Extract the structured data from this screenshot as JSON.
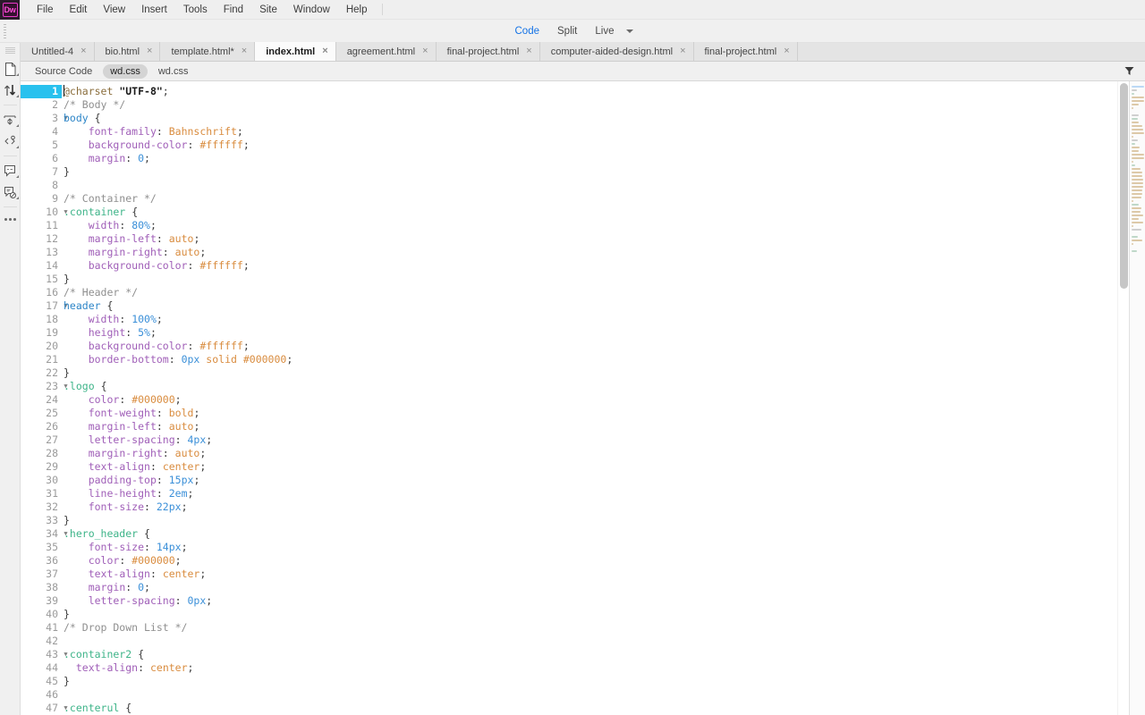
{
  "app": {
    "logo_text": "Dw",
    "menu": [
      "File",
      "Edit",
      "View",
      "Insert",
      "Tools",
      "Find",
      "Site",
      "Window",
      "Help"
    ]
  },
  "docbar": {
    "views": [
      {
        "label": "Code",
        "active": true
      },
      {
        "label": "Split",
        "active": false
      },
      {
        "label": "Live",
        "active": false
      }
    ],
    "caret_icon": "chevron-down-icon"
  },
  "rail": {
    "icons": [
      "file-manage-icon",
      "sort-transfer-icon",
      "insert-icon",
      "code-snippet-icon",
      "dom-panel-icon",
      "validation-icon",
      "more-options-icon"
    ]
  },
  "filetabs": [
    {
      "label": "Untitled-4",
      "active": false,
      "close": "×"
    },
    {
      "label": "bio.html",
      "active": false,
      "close": "×"
    },
    {
      "label": "template.html*",
      "active": false,
      "close": "×"
    },
    {
      "label": "index.html",
      "active": true,
      "close": "×"
    },
    {
      "label": "agreement.html",
      "active": false,
      "close": "×"
    },
    {
      "label": "final-project.html",
      "active": false,
      "close": "×"
    },
    {
      "label": "computer-aided-design.html",
      "active": false,
      "close": "×"
    },
    {
      "label": "final-project.html",
      "active": false,
      "close": "×"
    }
  ],
  "related_files": [
    {
      "label": "Source Code",
      "active": false
    },
    {
      "label": "wd.css",
      "active": true
    },
    {
      "label": "wd.css",
      "active": false
    }
  ],
  "toolbar_right": {
    "filter_icon": "filter-icon"
  },
  "editor": {
    "current_line": 1,
    "first_line": 1,
    "language": "css",
    "colors": {
      "selection": "#29c1ee",
      "selector": "#3eb489",
      "property": "#a05fb8",
      "value": "#d98c3f",
      "number": "#3a8fd8",
      "comment": "#8f8f8f",
      "tag": "#2e86c8",
      "accent": "#1473e6",
      "brand": "#ff4fd8"
    },
    "lines": [
      {
        "n": 1,
        "fold": "",
        "tokens": [
          {
            "t": "at",
            "v": "@charset"
          },
          {
            "t": "plain",
            "v": " "
          },
          {
            "t": "str",
            "v": "\"UTF-8\""
          },
          {
            "t": "punc",
            "v": ";"
          }
        ]
      },
      {
        "n": 2,
        "fold": "",
        "tokens": [
          {
            "t": "com",
            "v": "/* Body */"
          }
        ]
      },
      {
        "n": 3,
        "fold": "▼",
        "tokens": [
          {
            "t": "tag",
            "v": "body"
          },
          {
            "t": "plain",
            "v": " "
          },
          {
            "t": "punc",
            "v": "{"
          }
        ]
      },
      {
        "n": 4,
        "fold": "",
        "tokens": [
          {
            "t": "plain",
            "v": "    "
          },
          {
            "t": "prop",
            "v": "font-family"
          },
          {
            "t": "punc",
            "v": ": "
          },
          {
            "t": "val",
            "v": "Bahnschrift"
          },
          {
            "t": "punc",
            "v": ";"
          }
        ]
      },
      {
        "n": 5,
        "fold": "",
        "tokens": [
          {
            "t": "plain",
            "v": "    "
          },
          {
            "t": "prop",
            "v": "background-color"
          },
          {
            "t": "punc",
            "v": ": "
          },
          {
            "t": "hex",
            "v": "#ffffff"
          },
          {
            "t": "punc",
            "v": ";"
          }
        ]
      },
      {
        "n": 6,
        "fold": "",
        "tokens": [
          {
            "t": "plain",
            "v": "    "
          },
          {
            "t": "prop",
            "v": "margin"
          },
          {
            "t": "punc",
            "v": ": "
          },
          {
            "t": "num",
            "v": "0"
          },
          {
            "t": "punc",
            "v": ";"
          }
        ]
      },
      {
        "n": 7,
        "fold": "",
        "tokens": [
          {
            "t": "punc",
            "v": "}"
          }
        ]
      },
      {
        "n": 8,
        "fold": "",
        "tokens": []
      },
      {
        "n": 9,
        "fold": "",
        "tokens": [
          {
            "t": "com",
            "v": "/* Container */"
          }
        ]
      },
      {
        "n": 10,
        "fold": "▼",
        "tokens": [
          {
            "t": "sel",
            "v": ".container"
          },
          {
            "t": "plain",
            "v": " "
          },
          {
            "t": "punc",
            "v": "{"
          }
        ]
      },
      {
        "n": 11,
        "fold": "",
        "tokens": [
          {
            "t": "plain",
            "v": "    "
          },
          {
            "t": "prop",
            "v": "width"
          },
          {
            "t": "punc",
            "v": ": "
          },
          {
            "t": "num",
            "v": "80%"
          },
          {
            "t": "punc",
            "v": ";"
          }
        ]
      },
      {
        "n": 12,
        "fold": "",
        "tokens": [
          {
            "t": "plain",
            "v": "    "
          },
          {
            "t": "prop",
            "v": "margin-left"
          },
          {
            "t": "punc",
            "v": ": "
          },
          {
            "t": "val",
            "v": "auto"
          },
          {
            "t": "punc",
            "v": ";"
          }
        ]
      },
      {
        "n": 13,
        "fold": "",
        "tokens": [
          {
            "t": "plain",
            "v": "    "
          },
          {
            "t": "prop",
            "v": "margin-right"
          },
          {
            "t": "punc",
            "v": ": "
          },
          {
            "t": "val",
            "v": "auto"
          },
          {
            "t": "punc",
            "v": ";"
          }
        ]
      },
      {
        "n": 14,
        "fold": "",
        "tokens": [
          {
            "t": "plain",
            "v": "    "
          },
          {
            "t": "prop",
            "v": "background-color"
          },
          {
            "t": "punc",
            "v": ": "
          },
          {
            "t": "hex",
            "v": "#ffffff"
          },
          {
            "t": "punc",
            "v": ";"
          }
        ]
      },
      {
        "n": 15,
        "fold": "",
        "tokens": [
          {
            "t": "punc",
            "v": "}"
          }
        ]
      },
      {
        "n": 16,
        "fold": "",
        "tokens": [
          {
            "t": "com",
            "v": "/* Header */"
          }
        ]
      },
      {
        "n": 17,
        "fold": "▼",
        "tokens": [
          {
            "t": "tag",
            "v": "header"
          },
          {
            "t": "plain",
            "v": " "
          },
          {
            "t": "punc",
            "v": "{"
          }
        ]
      },
      {
        "n": 18,
        "fold": "",
        "tokens": [
          {
            "t": "plain",
            "v": "    "
          },
          {
            "t": "prop",
            "v": "width"
          },
          {
            "t": "punc",
            "v": ": "
          },
          {
            "t": "num",
            "v": "100%"
          },
          {
            "t": "punc",
            "v": ";"
          }
        ]
      },
      {
        "n": 19,
        "fold": "",
        "tokens": [
          {
            "t": "plain",
            "v": "    "
          },
          {
            "t": "prop",
            "v": "height"
          },
          {
            "t": "punc",
            "v": ": "
          },
          {
            "t": "num",
            "v": "5%"
          },
          {
            "t": "punc",
            "v": ";"
          }
        ]
      },
      {
        "n": 20,
        "fold": "",
        "tokens": [
          {
            "t": "plain",
            "v": "    "
          },
          {
            "t": "prop",
            "v": "background-color"
          },
          {
            "t": "punc",
            "v": ": "
          },
          {
            "t": "hex",
            "v": "#ffffff"
          },
          {
            "t": "punc",
            "v": ";"
          }
        ]
      },
      {
        "n": 21,
        "fold": "",
        "tokens": [
          {
            "t": "plain",
            "v": "    "
          },
          {
            "t": "prop",
            "v": "border-bottom"
          },
          {
            "t": "punc",
            "v": ": "
          },
          {
            "t": "num",
            "v": "0px"
          },
          {
            "t": "plain",
            "v": " "
          },
          {
            "t": "val",
            "v": "solid"
          },
          {
            "t": "plain",
            "v": " "
          },
          {
            "t": "hex",
            "v": "#000000"
          },
          {
            "t": "punc",
            "v": ";"
          }
        ]
      },
      {
        "n": 22,
        "fold": "",
        "tokens": [
          {
            "t": "punc",
            "v": "}"
          }
        ]
      },
      {
        "n": 23,
        "fold": "▼",
        "tokens": [
          {
            "t": "sel",
            "v": ".logo"
          },
          {
            "t": "plain",
            "v": " "
          },
          {
            "t": "punc",
            "v": "{"
          }
        ]
      },
      {
        "n": 24,
        "fold": "",
        "tokens": [
          {
            "t": "plain",
            "v": "    "
          },
          {
            "t": "prop",
            "v": "color"
          },
          {
            "t": "punc",
            "v": ": "
          },
          {
            "t": "hex",
            "v": "#000000"
          },
          {
            "t": "punc",
            "v": ";"
          }
        ]
      },
      {
        "n": 25,
        "fold": "",
        "tokens": [
          {
            "t": "plain",
            "v": "    "
          },
          {
            "t": "prop",
            "v": "font-weight"
          },
          {
            "t": "punc",
            "v": ": "
          },
          {
            "t": "val",
            "v": "bold"
          },
          {
            "t": "punc",
            "v": ";"
          }
        ]
      },
      {
        "n": 26,
        "fold": "",
        "tokens": [
          {
            "t": "plain",
            "v": "    "
          },
          {
            "t": "prop",
            "v": "margin-left"
          },
          {
            "t": "punc",
            "v": ": "
          },
          {
            "t": "val",
            "v": "auto"
          },
          {
            "t": "punc",
            "v": ";"
          }
        ]
      },
      {
        "n": 27,
        "fold": "",
        "tokens": [
          {
            "t": "plain",
            "v": "    "
          },
          {
            "t": "prop",
            "v": "letter-spacing"
          },
          {
            "t": "punc",
            "v": ": "
          },
          {
            "t": "num",
            "v": "4px"
          },
          {
            "t": "punc",
            "v": ";"
          }
        ]
      },
      {
        "n": 28,
        "fold": "",
        "tokens": [
          {
            "t": "plain",
            "v": "    "
          },
          {
            "t": "prop",
            "v": "margin-right"
          },
          {
            "t": "punc",
            "v": ": "
          },
          {
            "t": "val",
            "v": "auto"
          },
          {
            "t": "punc",
            "v": ";"
          }
        ]
      },
      {
        "n": 29,
        "fold": "",
        "tokens": [
          {
            "t": "plain",
            "v": "    "
          },
          {
            "t": "prop",
            "v": "text-align"
          },
          {
            "t": "punc",
            "v": ": "
          },
          {
            "t": "val",
            "v": "center"
          },
          {
            "t": "punc",
            "v": ";"
          }
        ]
      },
      {
        "n": 30,
        "fold": "",
        "tokens": [
          {
            "t": "plain",
            "v": "    "
          },
          {
            "t": "prop",
            "v": "padding-top"
          },
          {
            "t": "punc",
            "v": ": "
          },
          {
            "t": "num",
            "v": "15px"
          },
          {
            "t": "punc",
            "v": ";"
          }
        ]
      },
      {
        "n": 31,
        "fold": "",
        "tokens": [
          {
            "t": "plain",
            "v": "    "
          },
          {
            "t": "prop",
            "v": "line-height"
          },
          {
            "t": "punc",
            "v": ": "
          },
          {
            "t": "num",
            "v": "2em"
          },
          {
            "t": "punc",
            "v": ";"
          }
        ]
      },
      {
        "n": 32,
        "fold": "",
        "tokens": [
          {
            "t": "plain",
            "v": "    "
          },
          {
            "t": "prop",
            "v": "font-size"
          },
          {
            "t": "punc",
            "v": ": "
          },
          {
            "t": "num",
            "v": "22px"
          },
          {
            "t": "punc",
            "v": ";"
          }
        ]
      },
      {
        "n": 33,
        "fold": "",
        "tokens": [
          {
            "t": "punc",
            "v": "}"
          }
        ]
      },
      {
        "n": 34,
        "fold": "▼",
        "tokens": [
          {
            "t": "sel",
            "v": ".hero_header"
          },
          {
            "t": "plain",
            "v": " "
          },
          {
            "t": "punc",
            "v": "{"
          }
        ]
      },
      {
        "n": 35,
        "fold": "",
        "tokens": [
          {
            "t": "plain",
            "v": "    "
          },
          {
            "t": "prop",
            "v": "font-size"
          },
          {
            "t": "punc",
            "v": ": "
          },
          {
            "t": "num",
            "v": "14px"
          },
          {
            "t": "punc",
            "v": ";"
          }
        ]
      },
      {
        "n": 36,
        "fold": "",
        "tokens": [
          {
            "t": "plain",
            "v": "    "
          },
          {
            "t": "prop",
            "v": "color"
          },
          {
            "t": "punc",
            "v": ": "
          },
          {
            "t": "hex",
            "v": "#000000"
          },
          {
            "t": "punc",
            "v": ";"
          }
        ]
      },
      {
        "n": 37,
        "fold": "",
        "tokens": [
          {
            "t": "plain",
            "v": "    "
          },
          {
            "t": "prop",
            "v": "text-align"
          },
          {
            "t": "punc",
            "v": ": "
          },
          {
            "t": "val",
            "v": "center"
          },
          {
            "t": "punc",
            "v": ";"
          }
        ]
      },
      {
        "n": 38,
        "fold": "",
        "tokens": [
          {
            "t": "plain",
            "v": "    "
          },
          {
            "t": "prop",
            "v": "margin"
          },
          {
            "t": "punc",
            "v": ": "
          },
          {
            "t": "num",
            "v": "0"
          },
          {
            "t": "punc",
            "v": ";"
          }
        ]
      },
      {
        "n": 39,
        "fold": "",
        "tokens": [
          {
            "t": "plain",
            "v": "    "
          },
          {
            "t": "prop",
            "v": "letter-spacing"
          },
          {
            "t": "punc",
            "v": ": "
          },
          {
            "t": "num",
            "v": "0px"
          },
          {
            "t": "punc",
            "v": ";"
          }
        ]
      },
      {
        "n": 40,
        "fold": "",
        "tokens": [
          {
            "t": "punc",
            "v": "}"
          }
        ]
      },
      {
        "n": 41,
        "fold": "",
        "tokens": [
          {
            "t": "com",
            "v": "/* Drop Down List */"
          }
        ]
      },
      {
        "n": 42,
        "fold": "",
        "tokens": []
      },
      {
        "n": 43,
        "fold": "▼",
        "tokens": [
          {
            "t": "sel",
            "v": ".container2"
          },
          {
            "t": "plain",
            "v": " "
          },
          {
            "t": "punc",
            "v": "{"
          }
        ]
      },
      {
        "n": 44,
        "fold": "",
        "tokens": [
          {
            "t": "plain",
            "v": "  "
          },
          {
            "t": "prop",
            "v": "text-align"
          },
          {
            "t": "punc",
            "v": ": "
          },
          {
            "t": "val",
            "v": "center"
          },
          {
            "t": "punc",
            "v": ";"
          }
        ]
      },
      {
        "n": 45,
        "fold": "",
        "tokens": [
          {
            "t": "punc",
            "v": "}"
          }
        ]
      },
      {
        "n": 46,
        "fold": "",
        "tokens": []
      },
      {
        "n": 47,
        "fold": "▼",
        "tokens": [
          {
            "t": "sel",
            "v": ".centerul"
          },
          {
            "t": "plain",
            "v": " "
          },
          {
            "t": "punc",
            "v": "{"
          }
        ]
      }
    ]
  }
}
